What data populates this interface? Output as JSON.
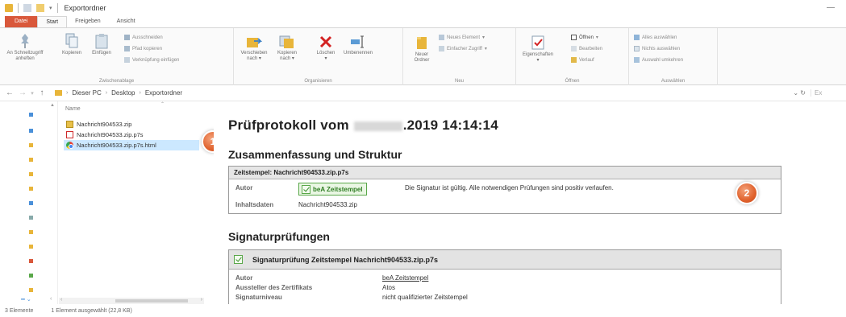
{
  "window": {
    "title": "Exportordner",
    "minimize_glyph": "—"
  },
  "ribbon_tabs": [
    {
      "label": "Datei"
    },
    {
      "label": "Start"
    },
    {
      "label": "Freigeben"
    },
    {
      "label": "Ansicht"
    }
  ],
  "ribbon": {
    "clipboard": {
      "pin_label_1": "An Schnellzugriff",
      "pin_label_2": "anheften",
      "copy_label": "Kopieren",
      "paste_label": "Einfügen",
      "cut": "Ausschneiden",
      "copy_path": "Pfad kopieren",
      "paste_shortcut": "Verknüpfung einfügen",
      "group": "Zwischenablage"
    },
    "organize": {
      "move_to_1": "Verschieben",
      "move_to_2": "nach",
      "copy_to_1": "Kopieren",
      "copy_to_2": "nach",
      "delete": "Löschen",
      "rename": "Umbenennen",
      "group": "Organisieren"
    },
    "new": {
      "new_folder_1": "Neuer",
      "new_folder_2": "Ordner",
      "new_item": "Neues Element",
      "easy_access": "Einfacher Zugriff",
      "group": "Neu"
    },
    "open": {
      "properties": "Eigenschaften",
      "open": "Öffnen",
      "edit": "Bearbeiten",
      "history": "Verlauf",
      "group": "Öffnen"
    },
    "select": {
      "select_all": "Alles auswählen",
      "select_none": "Nichts auswählen",
      "invert": "Auswahl umkehren",
      "group": "Auswählen"
    }
  },
  "address": {
    "crumbs": [
      "Dieser PC",
      "Desktop",
      "Exportordner"
    ],
    "search_placeholder": "Ex"
  },
  "filelist": {
    "column_name": "Name",
    "files": [
      {
        "name": "Nachricht904533.zip",
        "type": "zip"
      },
      {
        "name": "Nachricht904533.zip.p7s",
        "type": "p7s"
      },
      {
        "name": "Nachricht904533.zip.p7s.html",
        "type": "html",
        "selected": true
      }
    ]
  },
  "statusbar": {
    "count": "3 Elemente",
    "selection": "1 Element ausgewählt (22,8 KB)"
  },
  "badges": [
    "1",
    "2"
  ],
  "preview": {
    "title_prefix": "Prüfprotokoll vom",
    "title_suffix": ".2019 14:14:14",
    "summary_heading": "Zusammenfassung und Struktur",
    "timestamp_box": {
      "header": "Zeitstempel: Nachricht904533.zip.p7s",
      "author_key": "Autor",
      "author_chip": "beA Zeitstempel",
      "signature_text": "Die Signatur ist gültig. Alle notwendigen Prüfungen sind positiv verlaufen.",
      "content_key": "Inhaltsdaten",
      "content_value": "Nachricht904533.zip"
    },
    "signature_heading": "Signaturprüfungen",
    "signature_box": {
      "header": "Signaturprüfung Zeitstempel Nachricht904533.zip.p7s",
      "rows": [
        {
          "key": "Autor",
          "value": "beA Zeitstempel"
        },
        {
          "key": "Aussteller des Zertifikats",
          "value": "Atos"
        },
        {
          "key": "Signaturniveau",
          "value": "nicht qualifizierter Zeitstempel"
        }
      ]
    }
  },
  "colors": {
    "file_tab": "#d9583b",
    "selection": "#cce8ff",
    "badge": "#e0622d",
    "valid_green": "#5aa84a"
  }
}
